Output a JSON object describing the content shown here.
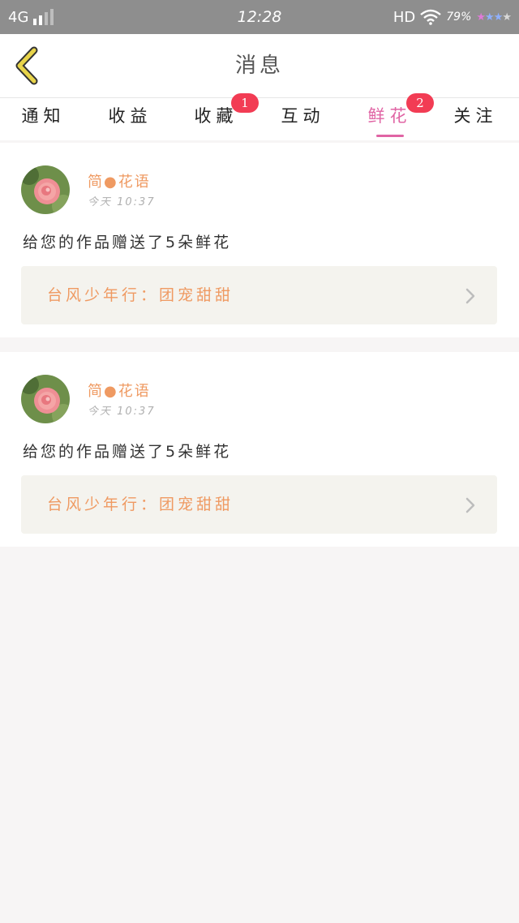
{
  "status_bar": {
    "network": "4G",
    "time": "12:28",
    "hd": "HD",
    "battery": "79%",
    "icons": [
      "signal-icon",
      "wifi-icon",
      "star-icon"
    ]
  },
  "header": {
    "title": "消息",
    "back_icon": "chevron-left-icon",
    "back_color": "#e8d44a"
  },
  "tabs": [
    {
      "label": "通知",
      "badge": null
    },
    {
      "label": "收益",
      "badge": null
    },
    {
      "label": "收藏",
      "badge": "1"
    },
    {
      "label": "互动",
      "badge": null
    },
    {
      "label": "鲜花",
      "badge": "2",
      "active": true
    },
    {
      "label": "关注",
      "badge": null
    }
  ],
  "messages": [
    {
      "sender": "简●花语",
      "time": "今天  10:37",
      "text": "给您的作品赠送了5朵鲜花",
      "work": "台风少年行：团宠甜甜"
    },
    {
      "sender": "简●花语",
      "time": "今天  10:37",
      "text": "给您的作品赠送了5朵鲜花",
      "work": "台风少年行：团宠甜甜"
    }
  ],
  "colors": {
    "accent": "#e064a4",
    "badge": "#f23c54",
    "sender": "#ef9a62",
    "status_bar": "#8e8e8e"
  }
}
